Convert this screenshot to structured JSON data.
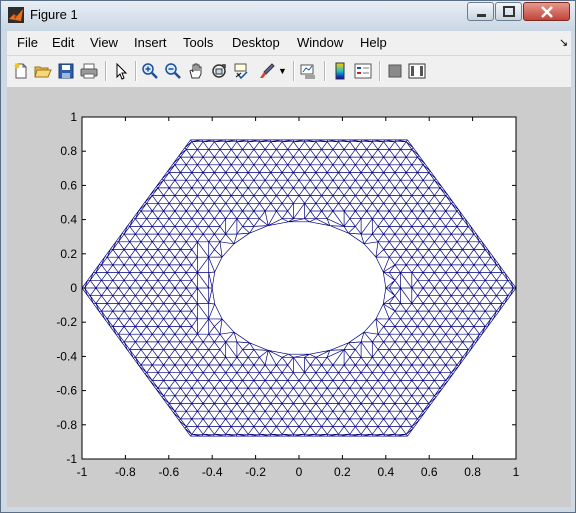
{
  "window": {
    "title": "Figure 1"
  },
  "menu": [
    "File",
    "Edit",
    "View",
    "Insert",
    "Tools",
    "Desktop",
    "Window",
    "Help"
  ],
  "menu_overflow_icon": "arrow-icon",
  "toolbar_icons": [
    "new-figure-icon",
    "open-file-icon",
    "save-icon",
    "print-icon",
    "pointer-icon",
    "zoom-in-icon",
    "zoom-out-icon",
    "pan-hand-icon",
    "rotate-3d-icon",
    "data-cursor-icon",
    "brush-icon",
    "brush-dropdown-icon",
    "link-plot-icon",
    "colorbar-icon",
    "legend-icon",
    "hide-plot-tools-icon",
    "show-plot-tools-icon"
  ],
  "plot": {
    "xticks": [
      "-1",
      "-0.8",
      "-0.6",
      "-0.4",
      "-0.2",
      "0",
      "0.2",
      "0.4",
      "0.6",
      "0.8",
      "1"
    ],
    "yticks": [
      "1",
      "0.8",
      "0.6",
      "0.4",
      "0.2",
      "0",
      "-0.2",
      "-0.4",
      "-0.6",
      "-0.8",
      "-1"
    ],
    "mesh_color": "#00007f"
  },
  "chart_data": {
    "type": "triangular mesh",
    "xlim": [
      -1,
      1
    ],
    "ylim": [
      -1,
      1
    ],
    "outer_boundary": "hexagon",
    "outer_vertices": [
      [
        1,
        0
      ],
      [
        0.5,
        0.866
      ],
      [
        -0.5,
        0.866
      ],
      [
        -1,
        0
      ],
      [
        -0.5,
        -0.866
      ],
      [
        0.5,
        -0.866
      ]
    ],
    "hole_boundary": "ellipse",
    "hole_center": [
      0,
      0
    ],
    "hole_radii": [
      0.4,
      0.39
    ],
    "grid": false
  }
}
